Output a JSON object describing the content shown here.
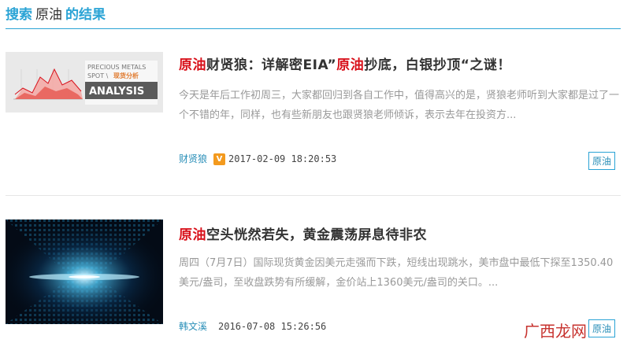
{
  "header": {
    "prefix": "搜索",
    "keyword": "原油",
    "suffix": "的结果"
  },
  "results": [
    {
      "thumb": {
        "line1": "PRECIOUS METALS",
        "line2": "SPOT \\",
        "line2b": "现货分析",
        "line3": "ANALYSIS"
      },
      "title": {
        "hl1": "原油",
        "t1": "财贤狼：详解密EIA”",
        "hl2": "原油",
        "t2": "抄底，白银抄顶“之谜！"
      },
      "summary": "今天是年后工作初周三，大家都回归到各自工作中，值得高兴的是，贤狼老师听到大家都是过了一个不错的年，同样，也有些新朋友也跟贤狼老师倾诉，表示去年在投资方...",
      "author": "财贤狼",
      "badge": "V",
      "date": "2017-02-09 18:20:53",
      "tag": "原油"
    },
    {
      "title": {
        "hl1": "原油",
        "t1": "空头恍然若失，黄金震荡屏息待非农"
      },
      "summary": "周四（7月7日）国际现货黄金因美元走强而下跌，短线出现跳水，美市盘中最低下探至1350.40美元/盎司，至收盘跌势有所缓解，金价站上1360美元/盎司的关口。...",
      "author": "韩文溪",
      "date": "2016-07-08 15:26:56",
      "tag": "原油"
    }
  ],
  "watermark": "广西龙网",
  "colors": {
    "accent": "#2aa3d5",
    "highlight": "#d8101a",
    "badge": "#f39a1e"
  }
}
